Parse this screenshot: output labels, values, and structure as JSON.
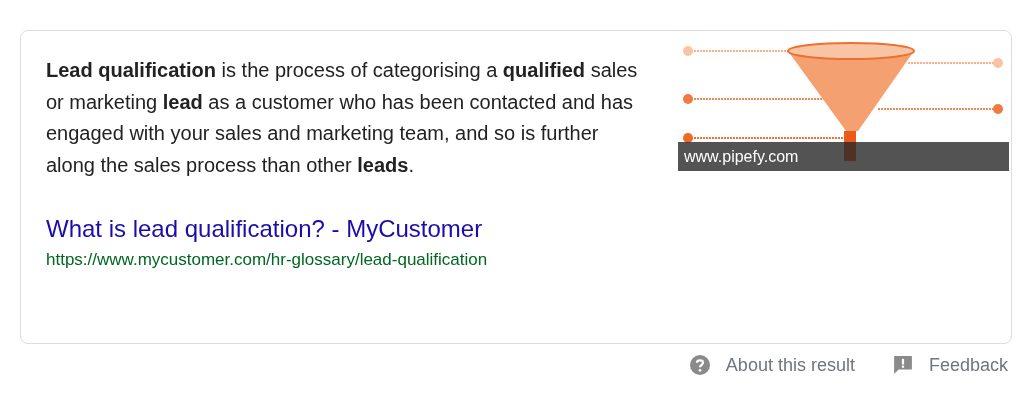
{
  "snippet": {
    "text": "**Lead qualification** is the process of categorising a **qualified** sales or marketing **lead** as a customer who has been contacted and has engaged with your sales and marketing team, and so is further along the sales process than other **leads**.",
    "image": {
      "kind": "picture",
      "caption": "www.pipefy.com"
    },
    "link": {
      "title": "What is lead qualification? - MyCustomer",
      "url": "https://www.mycustomer.com/hr-glossary/lead-qualification"
    }
  },
  "footer": [
    {
      "kind": "about",
      "label": "About this result"
    },
    {
      "kind": "feedback",
      "label": "Feedback"
    }
  ]
}
